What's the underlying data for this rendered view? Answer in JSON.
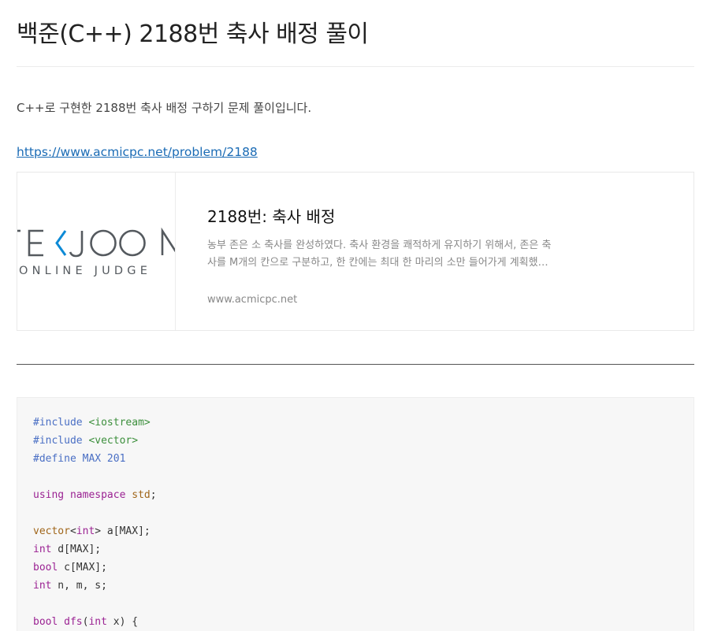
{
  "post": {
    "title": "백준(C++) 2188번 축사 배정 풀이",
    "intro": "C++로 구현한 2188번 축사 배정 구하기 문제 풀이입니다.",
    "link": "https://www.acmicpc.net/problem/2188"
  },
  "card": {
    "logo_main": "BAEKJOON",
    "logo_sub": "ONLINE JUDGE",
    "title": "2188번: 축사 배정",
    "description_line1": "농부 존은 소 축사를 완성하였다. 축사 환경을 쾌적하게 유지하기 위해서, 존은 축",
    "description_line2": "사를 M개의 칸으로 구분하고, 한 칸에는 최대 한 마리의 소만 들어가게 계획했…",
    "host": "www.acmicpc.net",
    "colors": {
      "logo_gray": "#555a5f",
      "logo_blue": "#0d8ad6"
    }
  },
  "code": {
    "lines": [
      [
        {
          "t": "#include ",
          "c": "pp"
        },
        {
          "t": "<iostream>",
          "c": "str"
        }
      ],
      [
        {
          "t": "#include ",
          "c": "pp"
        },
        {
          "t": "<vector>",
          "c": "str"
        }
      ],
      [
        {
          "t": "#define MAX 201",
          "c": "pp"
        }
      ],
      [],
      [
        {
          "t": "using",
          "c": "kw"
        },
        {
          "t": " "
        },
        {
          "t": "namespace",
          "c": "kw"
        },
        {
          "t": " "
        },
        {
          "t": "std",
          "c": "ty"
        },
        {
          "t": ";"
        }
      ],
      [],
      [
        {
          "t": "vector",
          "c": "ty"
        },
        {
          "t": "<"
        },
        {
          "t": "int",
          "c": "kw"
        },
        {
          "t": "> a[MAX];"
        }
      ],
      [
        {
          "t": "int",
          "c": "kw"
        },
        {
          "t": " d[MAX];"
        }
      ],
      [
        {
          "t": "bool",
          "c": "kw"
        },
        {
          "t": " c[MAX];"
        }
      ],
      [
        {
          "t": "int",
          "c": "kw"
        },
        {
          "t": " n, m, s;"
        }
      ],
      [],
      [
        {
          "t": "bool",
          "c": "kw"
        },
        {
          "t": " "
        },
        {
          "t": "dfs",
          "c": "fn"
        },
        {
          "t": "("
        },
        {
          "t": "int",
          "c": "kw"
        },
        {
          "t": " x) {"
        }
      ]
    ]
  }
}
